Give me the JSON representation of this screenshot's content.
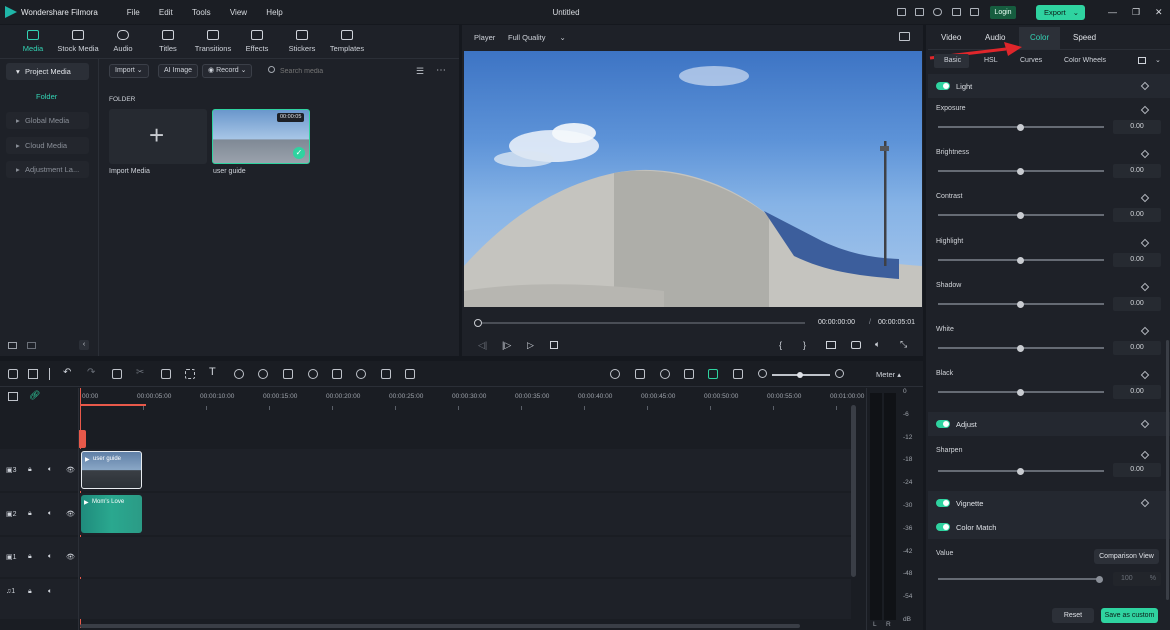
{
  "app": {
    "name": "Wondershare Filmora",
    "title": "Untitled",
    "login": "Login",
    "export": "Export"
  },
  "menu": [
    "File",
    "Edit",
    "Tools",
    "View",
    "Help"
  ],
  "tabs": [
    {
      "label": "Media",
      "icon": "media-icon"
    },
    {
      "label": "Stock Media",
      "icon": "stock-media-icon"
    },
    {
      "label": "Audio",
      "icon": "music-note-icon"
    },
    {
      "label": "Titles",
      "icon": "titles-t-icon"
    },
    {
      "label": "Transitions",
      "icon": "transitions-icon"
    },
    {
      "label": "Effects",
      "icon": "effects-icon"
    },
    {
      "label": "Stickers",
      "icon": "stickers-icon"
    },
    {
      "label": "Templates",
      "icon": "templates-icon"
    }
  ],
  "sidebar": {
    "items": [
      "Project Media",
      "Folder",
      "Global Media",
      "Cloud Media",
      "Adjustment La..."
    ]
  },
  "media_toolbar": {
    "import": "Import",
    "ai_image": "AI Image",
    "record": "Record",
    "search_placeholder": "Search media"
  },
  "media": {
    "section": "FOLDER",
    "import_label": "Import Media",
    "clip_label": "user guide",
    "clip_duration": "00:00:05"
  },
  "player": {
    "label": "Player",
    "quality": "Full Quality",
    "current_time": "00:00:00:00",
    "separator": "/",
    "total_time": "00:00:05:01"
  },
  "right_panel": {
    "tabs": [
      "Video",
      "Audio",
      "Color",
      "Speed"
    ],
    "active_tab": "Color",
    "subtabs": [
      "Basic",
      "HSL",
      "Curves",
      "Color Wheels"
    ],
    "active_subtab": "Basic",
    "light": {
      "title": "Light",
      "sliders": [
        {
          "label": "Exposure",
          "value": "0.00"
        },
        {
          "label": "Brightness",
          "value": "0.00"
        },
        {
          "label": "Contrast",
          "value": "0.00"
        },
        {
          "label": "Highlight",
          "value": "0.00"
        },
        {
          "label": "Shadow",
          "value": "0.00"
        },
        {
          "label": "White",
          "value": "0.00"
        },
        {
          "label": "Black",
          "value": "0.00"
        }
      ]
    },
    "adjust": {
      "title": "Adjust",
      "sharpen_label": "Sharpen",
      "sharpen_value": "0.00"
    },
    "vignette": "Vignette",
    "color_match": "Color Match",
    "value_label": "Value",
    "comparison_view": "Comparison View",
    "value_amount": "100",
    "value_unit": "%",
    "reset": "Reset",
    "save_custom": "Save as custom"
  },
  "timeline": {
    "ticks": [
      "00:00",
      "00:00:05:00",
      "00:00:10:00",
      "00:00:15:00",
      "00:00:20:00",
      "00:00:25:00",
      "00:00:30:00",
      "00:00:35:00",
      "00:00:40:00",
      "00:00:45:00",
      "00:00:50:00",
      "00:00:55:00",
      "00:01:00:00"
    ],
    "track_numbers": [
      "3",
      "2",
      "1",
      "1"
    ],
    "clip1": "user guide",
    "clip2": "Mom's Love"
  },
  "meter": {
    "label": "Meter",
    "levels": [
      "0",
      "-6",
      "-12",
      "-18",
      "-24",
      "-30",
      "-36",
      "-42",
      "-48",
      "-54",
      "dB"
    ],
    "lr": [
      "L",
      "R"
    ]
  },
  "colors": {
    "accent": "#2fd3a0",
    "active_tab": "#33d3b4",
    "arrow": "#e0262b",
    "playhead": "#e8594a"
  }
}
